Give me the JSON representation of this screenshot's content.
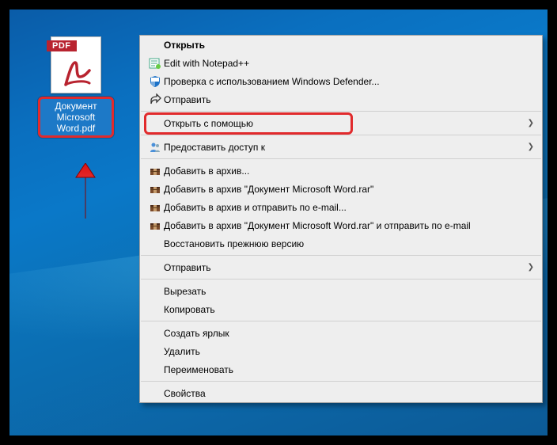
{
  "file": {
    "badge": "PDF",
    "label": "Документ Microsoft Word.pdf"
  },
  "menu": {
    "open": "Открыть",
    "edit_notepad": "Edit with Notepad++",
    "defender": "Проверка с использованием Windows Defender...",
    "send_short": "Отправить",
    "open_with": "Открыть с помощью",
    "grant_access": "Предоставить доступ к",
    "rar_add": "Добавить в архив...",
    "rar_add_named": "Добавить в архив \"Документ Microsoft Word.rar\"",
    "rar_email": "Добавить в архив и отправить по e-mail...",
    "rar_named_email": "Добавить в архив \"Документ Microsoft Word.rar\" и отправить по e-mail",
    "restore": "Восстановить прежнюю версию",
    "send_to": "Отправить",
    "cut": "Вырезать",
    "copy": "Копировать",
    "shortcut": "Создать ярлык",
    "delete": "Удалить",
    "rename": "Переименовать",
    "properties": "Свойства"
  },
  "callout_colors": {
    "arrow": "#e12a2c"
  }
}
